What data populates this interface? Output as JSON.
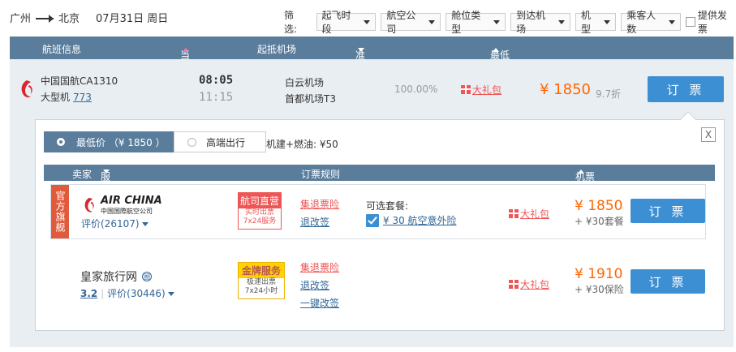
{
  "route": {
    "from": "广州",
    "to": "北京",
    "date": "07月31日 周日"
  },
  "filters": {
    "label": "筛选:",
    "items": [
      "起飞时段",
      "航空公司",
      "舱位类型",
      "到达机场",
      "机型",
      "乘客人数"
    ],
    "checkbox_label": "提供发票"
  },
  "header": {
    "flight_info": "航班信息",
    "time": "当地起降时间",
    "airport": "起抵机场",
    "ontime": "准点率",
    "price": "最低价格（不含税费）"
  },
  "flight": {
    "airline": "中国国航CA1310",
    "plane_type": "大型机",
    "plane_model": "773",
    "dep_time": "08:05",
    "arr_time": "11:15",
    "dep_airport": "白云机场",
    "arr_airport": "首都机场T3",
    "ontime_rate": "100.00%",
    "gift": "大礼包",
    "price": "¥ 1850",
    "discount": "9.7折",
    "book_label": "订 票"
  },
  "panel": {
    "tab_low": "最低价 （¥ 1850 ）",
    "tab_high": "高端出行",
    "fuel": "机建+燃油: ¥50",
    "close": "X",
    "sub_head": {
      "seller": "卖家",
      "rating": "服务评分",
      "rules": "订票规则",
      "price": "机票价格（不含税费）"
    },
    "sellers": [
      {
        "official_tag": "官方旗舰",
        "logo_text": "AIR CHINA",
        "logo_cn": "中国国際航空公司",
        "rating": "评价(26107)",
        "badge_title": "航司直营",
        "badge_sub1": "实时出票",
        "badge_sub2": "7x24服务",
        "rule1": "集退票险",
        "rule2": "退改签",
        "pkg_title": "可选套餐:",
        "pkg_text": "¥ 30 航空意外险",
        "gift": "大礼包",
        "price": "¥ 1850",
        "price_sub": "+ ¥30套餐",
        "book_label": "订 票"
      },
      {
        "name": "皇家旅行网",
        "name_icon": "圈",
        "score": "3.2",
        "rating": "评价(30446)",
        "badge_title": "金牌服务",
        "badge_sub1": "极速出票",
        "badge_sub2": "7x24小时",
        "rule1": "集退票险",
        "rule2": "退改签",
        "rule3": "一键改签",
        "gift": "大礼包",
        "price": "¥ 1910",
        "price_sub": "+ ¥30保险",
        "book_label": "订 票"
      }
    ]
  }
}
